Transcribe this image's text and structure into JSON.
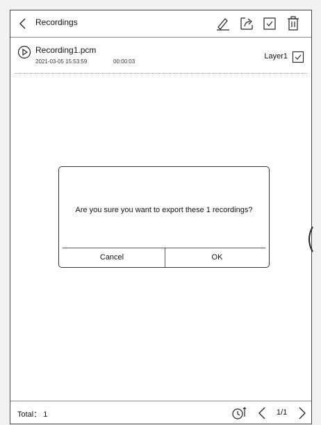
{
  "header": {
    "title": "Recordings",
    "icons": [
      "back-icon",
      "pencil-icon",
      "export-icon",
      "checkbox-icon",
      "trash-icon"
    ]
  },
  "recordings": [
    {
      "name": "Recording1.pcm",
      "date": "2021-03-05 15:53:59",
      "duration": "00:00:03",
      "layer": "Layer1",
      "checked": true
    }
  ],
  "dialog": {
    "message": "Are you sure you want to export these 1 recordings?",
    "cancel_label": "Cancel",
    "ok_label": "OK"
  },
  "footer": {
    "total": "Total： 1",
    "page": "1/1",
    "icons": [
      "sort-time-icon",
      "prev-page-icon",
      "next-page-icon"
    ]
  }
}
